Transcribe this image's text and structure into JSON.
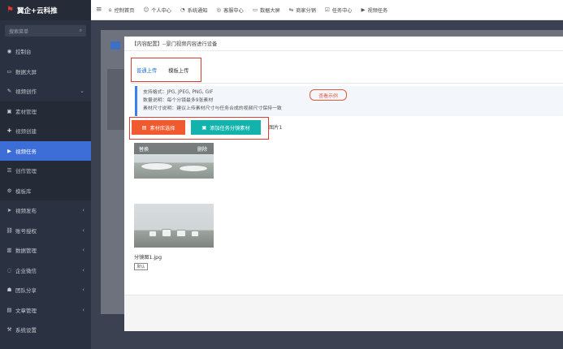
{
  "sidebar": {
    "brand": "翼企+云科推",
    "search_placeholder": "搜索菜单",
    "items": [
      {
        "label": "控制台",
        "icon": "dashboard-icon",
        "sub": false,
        "active": false,
        "caret": false
      },
      {
        "label": "数据大屏",
        "icon": "screen-icon",
        "sub": false,
        "active": false,
        "caret": false
      },
      {
        "label": "视频创作",
        "icon": "brush-icon",
        "sub": false,
        "active": false,
        "caret": true
      },
      {
        "label": "素材管理",
        "icon": "image-icon",
        "sub": true,
        "active": false,
        "caret": false
      },
      {
        "label": "视频创建",
        "icon": "plus-icon",
        "sub": true,
        "active": false,
        "caret": false
      },
      {
        "label": "视频任务",
        "icon": "video-icon",
        "sub": true,
        "active": true,
        "caret": false
      },
      {
        "label": "创作管理",
        "icon": "list-icon",
        "sub": true,
        "active": false,
        "caret": false
      },
      {
        "label": "模板库",
        "icon": "gear-icon",
        "sub": true,
        "active": false,
        "caret": false
      },
      {
        "label": "视频发布",
        "icon": "send-icon",
        "sub": false,
        "active": false,
        "caret": true
      },
      {
        "label": "账号授权",
        "icon": "link-icon",
        "sub": false,
        "active": false,
        "caret": true
      },
      {
        "label": "数据管理",
        "icon": "chart-icon",
        "sub": false,
        "active": false,
        "caret": true
      },
      {
        "label": "企业微信",
        "icon": "wechat-icon",
        "sub": false,
        "active": false,
        "caret": true
      },
      {
        "label": "团队分享",
        "icon": "team-icon",
        "sub": false,
        "active": false,
        "caret": true
      },
      {
        "label": "文章管理",
        "icon": "doc-icon",
        "sub": false,
        "active": false,
        "caret": true
      },
      {
        "label": "系统设置",
        "icon": "settings-icon",
        "sub": false,
        "active": false,
        "caret": false
      }
    ]
  },
  "topbar": {
    "tabs": [
      {
        "label": "控制首页",
        "icon": "home-icon"
      },
      {
        "label": "个人中心",
        "icon": "user-icon"
      },
      {
        "label": "系统通知",
        "icon": "bell-icon"
      },
      {
        "label": "客服中心",
        "icon": "headset-icon"
      },
      {
        "label": "数据大屏",
        "icon": "screen-icon"
      },
      {
        "label": "商家分销",
        "icon": "share-icon"
      },
      {
        "label": "任务中心",
        "icon": "task-icon"
      },
      {
        "label": "视频任务",
        "icon": "video-icon"
      }
    ]
  },
  "modal": {
    "title": "【内容配置】--景门视频内容进行设备",
    "tabs": [
      "普通上传",
      "模板上传"
    ],
    "notice": [
      "支持格式：JPG, JPEG, PNG, GIF",
      "数量说明：每个分镜最多9张素材",
      "素材尺寸说明：建议上传素材尺寸与任务合成的视频尺寸保持一致"
    ],
    "view_example": "查看示例",
    "btn_select": "素材库选择",
    "btn_template": "添加任务分镜素材",
    "count_text": "图片1",
    "thumb_left": "替换",
    "thumb_right": "删除",
    "filename": "分镜图1.jpg",
    "default_tag": "默认"
  },
  "colors": {
    "sidebar_bg": "#2a3140",
    "active": "#3d6ed8",
    "accent_red": "#f05a2e",
    "accent_teal": "#13b3ad",
    "highlight_border": "#e03a2f"
  }
}
